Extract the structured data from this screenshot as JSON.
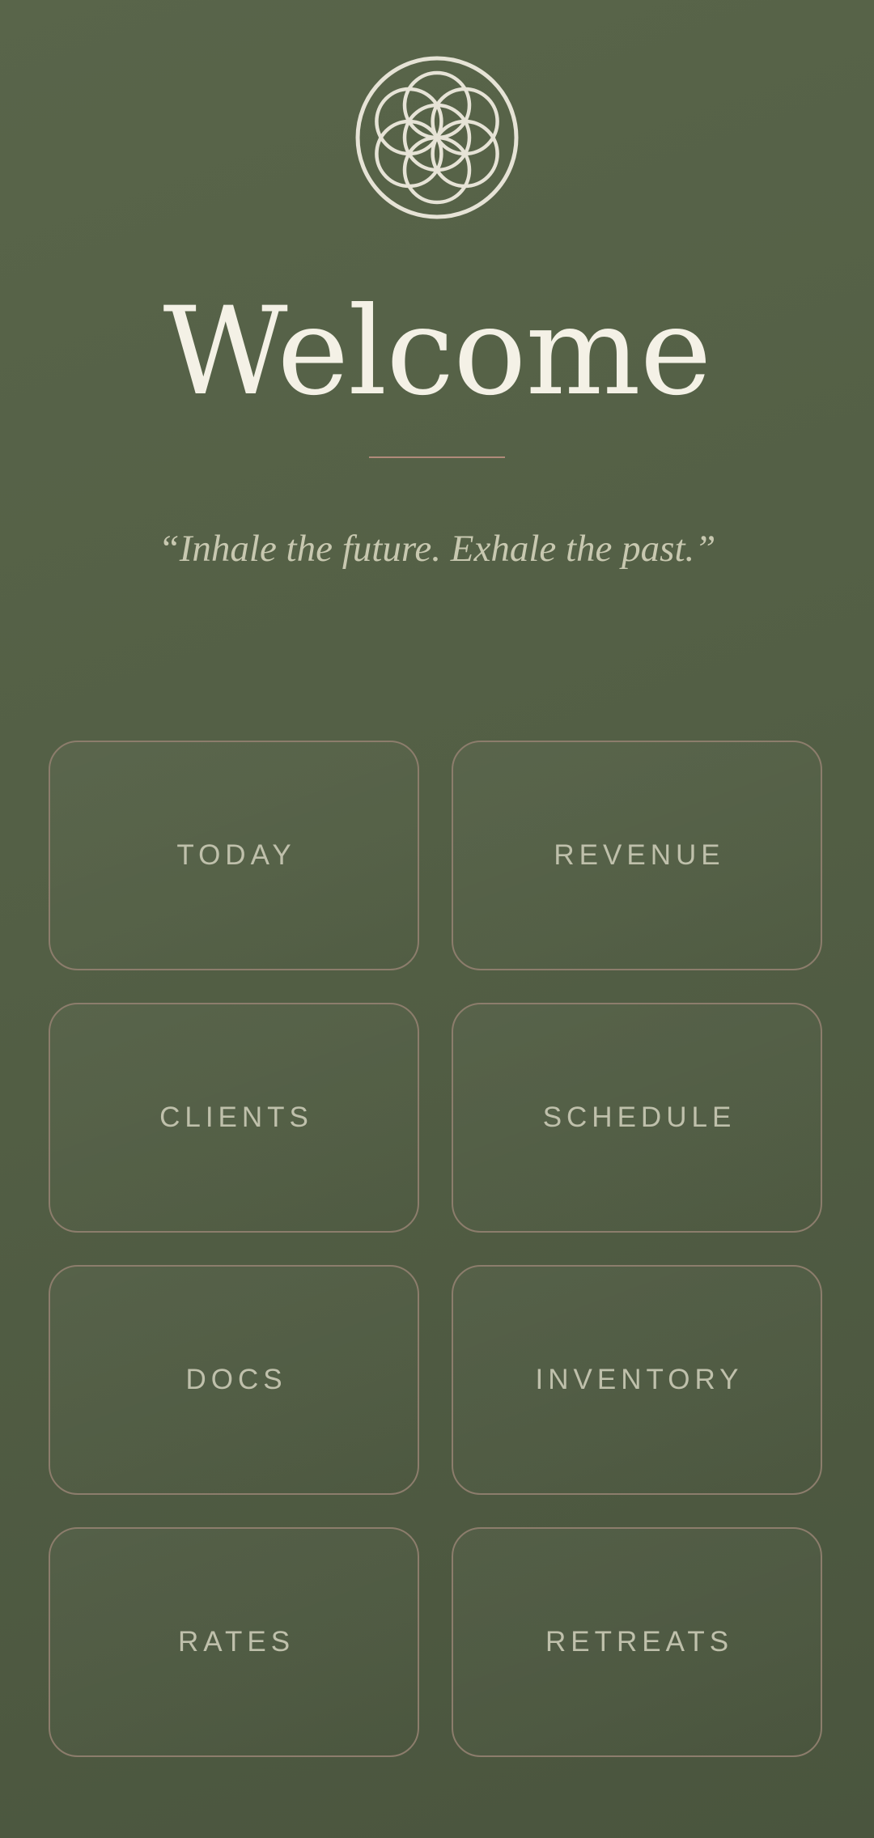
{
  "header": {
    "logo_icon": "flower-of-life-icon",
    "title": "Welcome",
    "quote": "“Inhale the future. Exhale the past.”"
  },
  "colors": {
    "background": "#535f45",
    "title": "#f4f1e6",
    "divider": "#b08a7a",
    "tile_border": "#8c7d6c",
    "tile_label": "#bfc0ab"
  },
  "menu": {
    "items": [
      {
        "label": "TODAY"
      },
      {
        "label": "REVENUE"
      },
      {
        "label": "CLIENTS"
      },
      {
        "label": "SCHEDULE"
      },
      {
        "label": "DOCS"
      },
      {
        "label": "INVENTORY"
      },
      {
        "label": "RATES"
      },
      {
        "label": "RETREATS"
      }
    ]
  }
}
